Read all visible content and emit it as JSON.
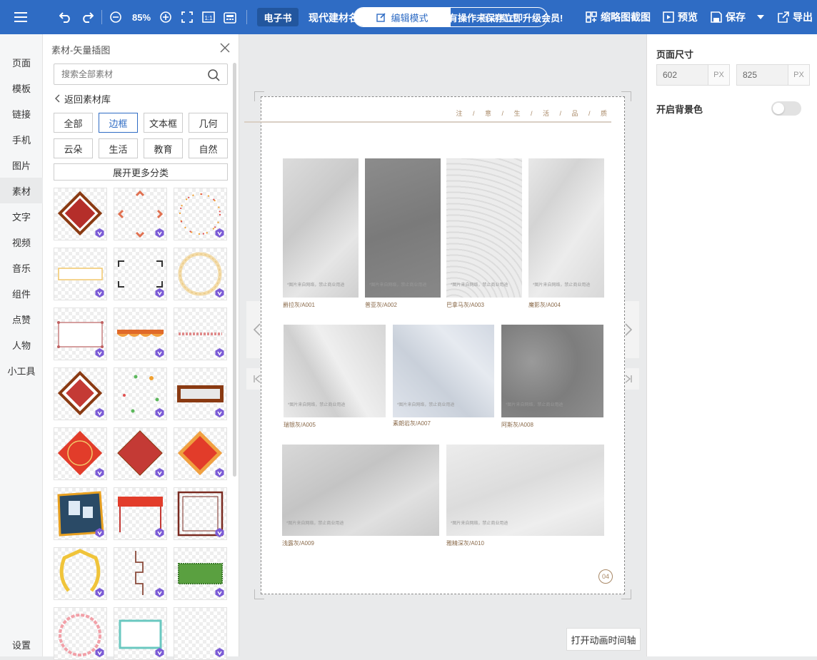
{
  "toolbar": {
    "zoom": "85%",
    "ebook_badge": "电子书",
    "doc_title": "现代建材名",
    "notice": "有操作未保存立即升级会员!",
    "mode_edit": "编辑模式",
    "mode_interact": "互动模式",
    "thumbnail": "缩略图截图",
    "preview": "预览",
    "save": "保存",
    "export": "导出"
  },
  "leftnav": {
    "items": [
      {
        "label": "页面"
      },
      {
        "label": "模板"
      },
      {
        "label": "链接"
      },
      {
        "label": "手机"
      },
      {
        "label": "图片"
      },
      {
        "label": "素材"
      },
      {
        "label": "文字"
      },
      {
        "label": "视频"
      },
      {
        "label": "音乐"
      },
      {
        "label": "组件"
      },
      {
        "label": "点赞"
      },
      {
        "label": "人物"
      },
      {
        "label": "小工具"
      }
    ],
    "settings": "设置",
    "active": "素材"
  },
  "panel": {
    "title": "素材-矢量插图",
    "search_placeholder": "搜索全部素材",
    "back": "返回素材库",
    "categories": [
      "全部",
      "边框",
      "文本框",
      "几何",
      "云朵",
      "生活",
      "教育",
      "自然"
    ],
    "active_category": "边框",
    "expand": "展开更多分类"
  },
  "canvas": {
    "header_text": "注 / 意 / 生 / 活 / 品 / 质",
    "swatch_note": "*图片来自网络，禁止商业用途",
    "swatches": [
      {
        "label": "爵拉灰/A001"
      },
      {
        "label": "普亚灰/A002"
      },
      {
        "label": "巴拿马灰/A003"
      },
      {
        "label": "魔影灰/A004"
      },
      {
        "label": "瑞银灰/A005"
      },
      {
        "label": "素朗岩灰/A007"
      },
      {
        "label": "阿斯灰/A008"
      },
      {
        "label": "浅露灰/A009"
      },
      {
        "label": "雅精深灰/A010"
      }
    ],
    "page_number": "04",
    "timeline_button": "打开动画时间轴"
  },
  "rightpanel": {
    "size_label": "页面尺寸",
    "width": "602",
    "height": "825",
    "unit": "PX",
    "bg_label": "开启背景色",
    "bg_enabled": false
  },
  "colors": {
    "brand": "#2f6cc4",
    "accent_text": "#a88866"
  }
}
